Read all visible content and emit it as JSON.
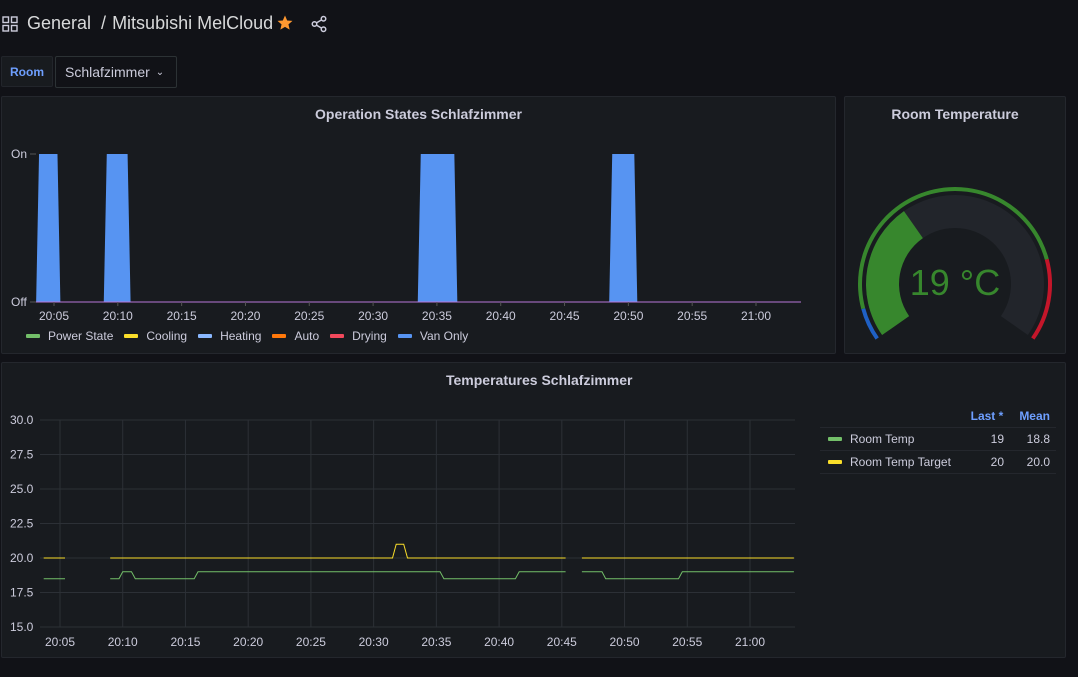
{
  "header": {
    "folder": "General",
    "separator": "/",
    "dashboard_title": "Mitsubishi MelCloud",
    "starred": true,
    "icons": [
      "apps-grid-icon",
      "star-icon",
      "share-icon"
    ]
  },
  "variables": {
    "room": {
      "label": "Room",
      "value": "Schlafzimmer"
    }
  },
  "colors": {
    "accent_blue": "#6e9fff",
    "star": "#ff9830",
    "power_state": "#73bf69",
    "cooling": "#fade2a",
    "heating": "#8ab8ff",
    "auto": "#ff780a",
    "drying": "#f2495c",
    "van_only": "#5794f2",
    "gauge_green": "#37872d",
    "gauge_blue": "#1f60c4",
    "gauge_red": "#c4162a"
  },
  "panels": {
    "operation_states": {
      "title": "Operation States Schlafzimmer"
    },
    "room_temperature": {
      "title": "Room Temperature",
      "value_text": "19 °C"
    },
    "temperatures": {
      "title": "Temperatures Schlafzimmer",
      "legend_headers": {
        "last": "Last *",
        "mean": "Mean"
      },
      "legend_rows": [
        {
          "name": "Room Temp",
          "last": "19",
          "mean": "18.8",
          "color": "#73bf69"
        },
        {
          "name": "Room Temp Target",
          "last": "20",
          "mean": "20.0",
          "color": "#fade2a"
        }
      ]
    }
  },
  "chart_data": [
    {
      "type": "area",
      "title": "Operation States Schlafzimmer",
      "x_unit": "time",
      "x_range": [
        "20:03.6",
        "21:03.6"
      ],
      "x_ticks": [
        "20:05",
        "20:10",
        "20:15",
        "20:20",
        "20:25",
        "20:30",
        "20:35",
        "20:40",
        "20:45",
        "20:50",
        "20:55",
        "21:00"
      ],
      "y_ticks": [
        "Off",
        "On"
      ],
      "ylim": [
        0,
        1
      ],
      "grid": false,
      "legend_position": "bottom-left",
      "series": [
        {
          "name": "Power State",
          "color": "#73bf69",
          "values": []
        },
        {
          "name": "Cooling",
          "color": "#fade2a",
          "values": []
        },
        {
          "name": "Heating",
          "color": "#8ab8ff",
          "values": []
        },
        {
          "name": "Auto",
          "color": "#ff780a",
          "values": []
        },
        {
          "name": "Drying",
          "color": "#f2495c",
          "values": []
        },
        {
          "name": "Van Only",
          "color": "#5794f2",
          "on_intervals": [
            [
              "20:03.6",
              "20:05.5"
            ],
            [
              "20:08.9",
              "20:11.0"
            ],
            [
              "20:33.5",
              "20:36.6"
            ],
            [
              "20:48.5",
              "20:50.7"
            ]
          ]
        }
      ]
    },
    {
      "type": "gauge",
      "title": "Room Temperature",
      "value": 19,
      "unit": "°C",
      "min": 10,
      "max": 35,
      "thresholds": [
        {
          "from": 10,
          "to": 12,
          "color": "#1f60c4"
        },
        {
          "from": 12,
          "to": 30,
          "color": "#37872d"
        },
        {
          "from": 30,
          "to": 35,
          "color": "#c4162a"
        }
      ]
    },
    {
      "type": "line",
      "title": "Temperatures Schlafzimmer",
      "x_ticks": [
        "20:05",
        "20:10",
        "20:15",
        "20:20",
        "20:25",
        "20:30",
        "20:35",
        "20:40",
        "20:45",
        "20:50",
        "20:55",
        "21:00"
      ],
      "y_ticks": [
        "15.0",
        "17.5",
        "20.0",
        "22.5",
        "25.0",
        "27.5",
        "30.0"
      ],
      "ylim": [
        15,
        30
      ],
      "grid": true,
      "legend_position": "right",
      "series": [
        {
          "name": "Room Temp",
          "color": "#73bf69",
          "segments": [
            [
              [
                "20:03.7",
                18.5
              ],
              [
                "20:05.4",
                18.5
              ]
            ],
            [
              [
                "20:09.0",
                18.5
              ],
              [
                "20:09.7",
                18.5
              ],
              [
                "20:10.0",
                19
              ],
              [
                "20:10.7",
                19
              ],
              [
                "20:11.0",
                18.5
              ],
              [
                "20:15.7",
                18.5
              ],
              [
                "20:16.0",
                19
              ],
              [
                "20:35.3",
                19
              ],
              [
                "20:35.6",
                18.5
              ],
              [
                "20:41.3",
                18.5
              ],
              [
                "20:41.6",
                19
              ],
              [
                "20:45.3",
                19
              ]
            ],
            [
              [
                "20:46.6",
                19
              ],
              [
                "20:48.2",
                19
              ],
              [
                "20:48.5",
                18.5
              ],
              [
                "20:54.3",
                18.5
              ],
              [
                "20:54.6",
                19
              ],
              [
                "21:03.5",
                19
              ]
            ]
          ]
        },
        {
          "name": "Room Temp Target",
          "color": "#fade2a",
          "segments": [
            [
              [
                "20:03.7",
                20
              ],
              [
                "20:05.4",
                20
              ]
            ],
            [
              [
                "20:09.0",
                20
              ],
              [
                "20:31.5",
                20
              ],
              [
                "20:31.8",
                21
              ],
              [
                "20:32.4",
                21
              ],
              [
                "20:32.7",
                20
              ],
              [
                "20:45.3",
                20
              ]
            ],
            [
              [
                "20:46.6",
                20
              ],
              [
                "21:03.5",
                20
              ]
            ]
          ]
        }
      ]
    }
  ]
}
